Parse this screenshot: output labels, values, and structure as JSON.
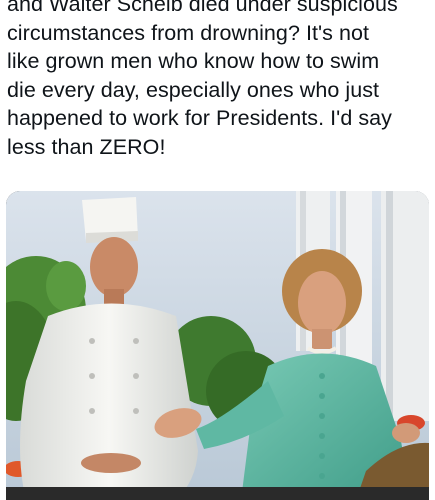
{
  "post": {
    "text": "and Walter Scheib died under suspicious\ncircumstances from drowning? It's not\nlike grown men who know how to swim\ndie every day, especially ones who just\nhappened to work for Presidents. I'd say\nless than ZERO!"
  },
  "media": {
    "kind": "photo",
    "colors": {
      "sky": "#c9d6e3",
      "foliage": "#3f7a2f",
      "chef_uniform": "#f2f2ef",
      "dress": "#5fb8a3",
      "hair": "#b8844a",
      "skin": "#d9a07e"
    }
  }
}
